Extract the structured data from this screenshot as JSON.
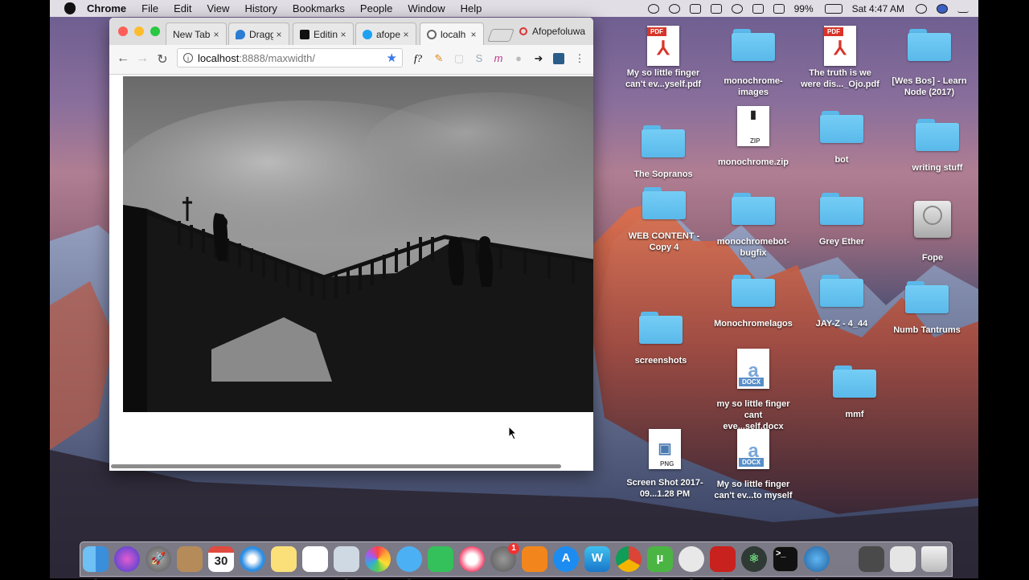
{
  "menubar": {
    "app_name": "Chrome",
    "menus": [
      "File",
      "Edit",
      "View",
      "History",
      "Bookmarks",
      "People",
      "Window",
      "Help"
    ],
    "battery": "99%",
    "clock": "Sat 4:47 AM"
  },
  "browser": {
    "tabs": [
      {
        "title": "New Tab",
        "close": "×"
      },
      {
        "title": "Dragg",
        "close": "×"
      },
      {
        "title": "Editin",
        "close": "×"
      },
      {
        "title": "afope",
        "close": "×"
      },
      {
        "title": "localh",
        "close": "×"
      }
    ],
    "profile_tab": "Afopefoluwa",
    "url_host": "localhost",
    "url_path": ":8888/maxwidth/",
    "ext_labels": [
      "f?",
      "m"
    ],
    "nav": {
      "back": "←",
      "forward": "→",
      "reload": "↻",
      "menu": "⋮"
    }
  },
  "desktop": {
    "icons": [
      {
        "label": "My so little finger can't ev...yself.pdf",
        "type": "pdf",
        "badge": "PDF"
      },
      {
        "label": "monochrome-images",
        "type": "folder"
      },
      {
        "label": "The truth is we were dis..._Ojo.pdf",
        "type": "pdf",
        "badge": "PDF"
      },
      {
        "label": "[Wes Bos] - Learn Node (2017)",
        "type": "folder"
      },
      {
        "label": "The Sopranos",
        "type": "folder"
      },
      {
        "label": "monochrome.zip",
        "type": "zip",
        "badge": "ZIP"
      },
      {
        "label": "bot",
        "type": "folder"
      },
      {
        "label": "writing stuff",
        "type": "folder"
      },
      {
        "label": "WEB CONTENT - Copy 4",
        "type": "folder"
      },
      {
        "label": "monochromebot-bugfix",
        "type": "folder"
      },
      {
        "label": "Grey Ether",
        "type": "folder"
      },
      {
        "label": "Fope",
        "type": "drive"
      },
      {
        "label": "Monochromelagos",
        "type": "folder"
      },
      {
        "label": "JAY-Z - 4_44",
        "type": "folder"
      },
      {
        "label": "Numb Tantrums",
        "type": "folder"
      },
      {
        "label": "screenshots",
        "type": "folder"
      },
      {
        "label": "my so little finger cant eve...self.docx",
        "type": "docx",
        "badge": "DOCX"
      },
      {
        "label": "mmf",
        "type": "folder"
      },
      {
        "label": "Screen Shot 2017-09...1.28 PM",
        "type": "png",
        "badge": "PNG"
      },
      {
        "label": "My so little finger can't ev...to myself",
        "type": "docx",
        "badge": "DOCX"
      }
    ]
  },
  "dock": {
    "calendar_day": "30",
    "prefs_badge": "1",
    "items": [
      "finder-icon",
      "siri-icon",
      "launchpad-icon",
      "contacts-icon",
      "calendar-icon",
      "safari-icon",
      "notes-icon",
      "reminders-icon",
      "preview-icon",
      "photos-icon",
      "messages-icon",
      "facetime-icon",
      "itunes-icon",
      "system-preferences-icon",
      "ibooks-icon",
      "app-store-icon",
      "webstorm-icon",
      "chrome-icon",
      "utorrent-icon",
      "elephant-icon",
      "acrobat-icon",
      "atom-icon",
      "terminal-icon",
      "quicktime-icon",
      "downloads-icon",
      "documents-icon",
      "trash-icon"
    ]
  }
}
